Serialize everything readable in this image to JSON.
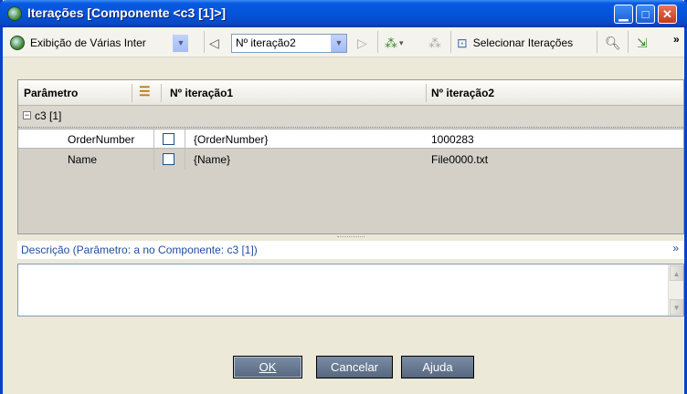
{
  "window": {
    "title": "Iterações [Componente <c3 [1]>]",
    "controls": [
      "minimize-icon",
      "maximize-icon",
      "close-icon"
    ]
  },
  "toolbar": {
    "view_combo_value": "Exibição de Várias Inter",
    "iteration_combo_value": "Nº iteração2",
    "select_iterations_label": "Selecionar Iterações",
    "overflow_glyph": "»"
  },
  "grid": {
    "columns": [
      "Parâmetro",
      "Nº iteração1",
      "Nº iteração2"
    ],
    "group_label": "c3 [1]",
    "rows": [
      {
        "parameter": "OrderNumber",
        "iteration1": "{OrderNumber}",
        "iteration2": "1000283"
      },
      {
        "parameter": "Name",
        "iteration1": "{Name}",
        "iteration2": "File0000.txt"
      }
    ]
  },
  "description": {
    "title": "Descrição (Parâmetro: a no Componente: c3 [1])",
    "value": ""
  },
  "buttons": {
    "ok": "OK",
    "cancel": "Cancelar",
    "help": "Ajuda"
  },
  "colors": {
    "titlebar": "#0a54da",
    "dialog_bg": "#ece9d8",
    "button": "#6a7b93",
    "link_text": "#1f4fa0"
  }
}
